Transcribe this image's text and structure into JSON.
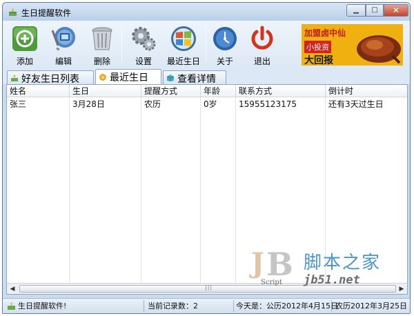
{
  "window": {
    "title": "生日提醒软件"
  },
  "toolbar": {
    "buttons": [
      {
        "label": "添加",
        "icon": "add-icon"
      },
      {
        "label": "编辑",
        "icon": "edit-icon"
      },
      {
        "label": "删除",
        "icon": "delete-icon"
      },
      {
        "label": "设置",
        "icon": "settings-icon"
      },
      {
        "label": "最近生日",
        "icon": "windows-logo-icon"
      },
      {
        "label": "关于",
        "icon": "info-icon"
      },
      {
        "label": "退出",
        "icon": "power-icon"
      }
    ]
  },
  "ad": {
    "line1": "加盟卤中仙",
    "line2": "小投资",
    "line3": "大回报"
  },
  "tabs": [
    {
      "label": "好友生日列表",
      "active": false
    },
    {
      "label": "最近生日",
      "active": true
    },
    {
      "label": "查看详情",
      "active": false
    }
  ],
  "table": {
    "columns": [
      "姓名",
      "生日",
      "提醒方式",
      "年龄",
      "联系方式",
      "倒计时"
    ],
    "rows": [
      [
        "张三",
        "3月28日",
        "农历",
        "0岁",
        "15955123175",
        "还有3天过生日"
      ]
    ]
  },
  "watermark": {
    "cn": "脚本之家",
    "url": "jb51.net",
    "script": "Script"
  },
  "status": {
    "app": "生日提醒软件!",
    "records": "当前记录数：2",
    "today": "今天是：公历2012年4月15日",
    "lunar": "农历2012年3月25日"
  },
  "colors": {
    "titlebar": "#c9dcf0",
    "ad_bg": "#f0b010",
    "watermark_blue": "#4a97cf"
  }
}
